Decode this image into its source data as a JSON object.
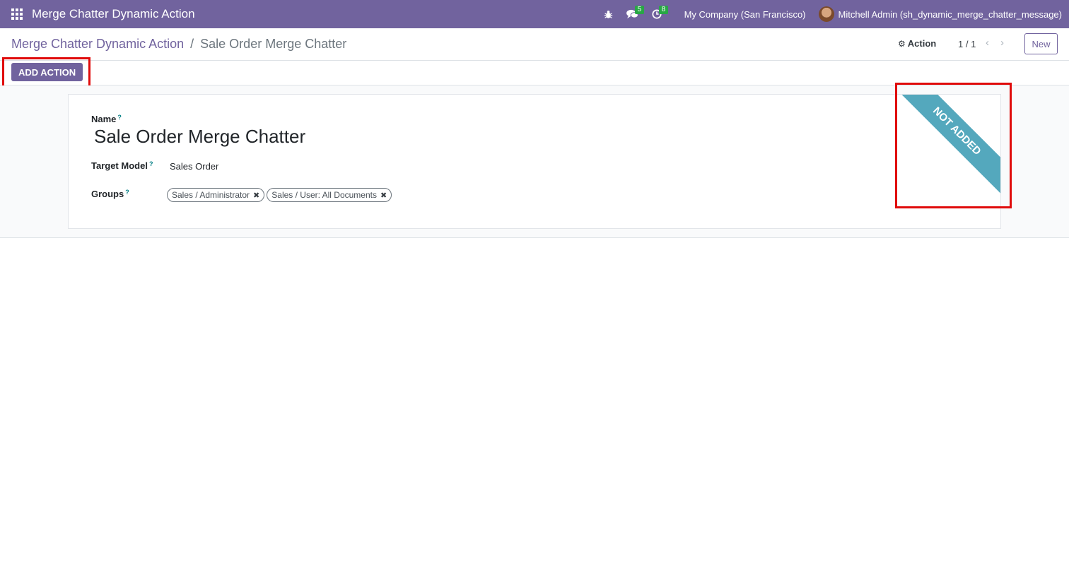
{
  "navbar": {
    "app_title": "Merge Chatter Dynamic Action",
    "messages_count": "5",
    "activities_count": "8",
    "company": "My Company (San Francisco)",
    "user": "Mitchell Admin (sh_dynamic_merge_chatter_message)",
    "icons": [
      "apps-grid-icon",
      "bug-icon",
      "chat-icon",
      "clock-icon"
    ],
    "color": "#71639e"
  },
  "control_panel": {
    "breadcrumb_parent": "Merge Chatter Dynamic Action",
    "breadcrumb_sep": "/",
    "breadcrumb_current": "Sale Order Merge Chatter",
    "action_label": "Action",
    "pager": "1 / 1",
    "new_label": "New"
  },
  "statusbar": {
    "add_action_label": "ADD ACTION"
  },
  "form": {
    "name_label": "Name",
    "name_value": "Sale Order Merge Chatter",
    "model_label": "Target Model",
    "model_value": "Sales Order",
    "groups_label": "Groups",
    "groups": [
      "Sales / Administrator",
      "Sales / User: All Documents"
    ],
    "help_mark": "?",
    "ribbon": "NOT ADDED",
    "ribbon_color": "#54a8bd"
  },
  "annotations": {
    "highlight_color": "#e00b0b"
  }
}
